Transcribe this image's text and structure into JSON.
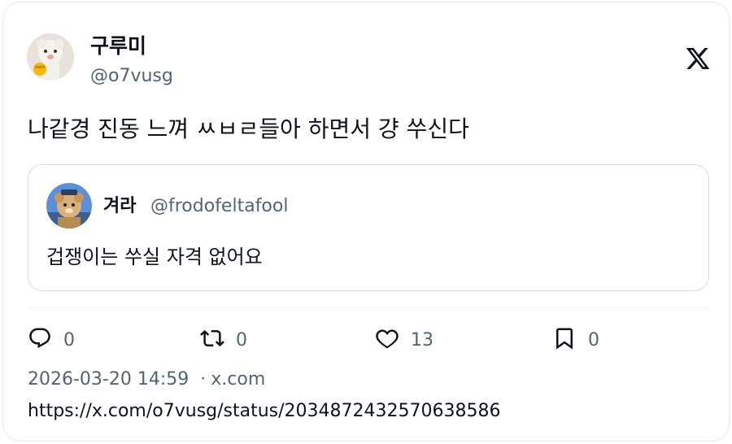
{
  "author": {
    "name": "구루미",
    "handle": "@o7vusg"
  },
  "tweet": {
    "text": "나같경 진동 느껴 ㅆㅂㄹ들아 하면서 걍 쑤신다"
  },
  "quoted": {
    "name": "겨라",
    "handle": "@frodofeltafool",
    "text": "겁쟁이는 쑤실 자격 없어요"
  },
  "actions": {
    "reply_count": "0",
    "repost_count": "0",
    "like_count": "13",
    "bookmark_count": "0"
  },
  "meta": {
    "timestamp": "2026-03-20 14:59",
    "separator": "·",
    "source": "x.com"
  },
  "url": "https://x.com/o7vusg/status/2034872432570638586",
  "icons": {
    "platform": "x-logo-icon",
    "reply": "reply-icon",
    "repost": "repost-icon",
    "like": "heart-icon",
    "bookmark": "bookmark-icon"
  },
  "colors": {
    "text": "#0f1419",
    "secondary": "#536471",
    "border": "#e6e8eb"
  }
}
